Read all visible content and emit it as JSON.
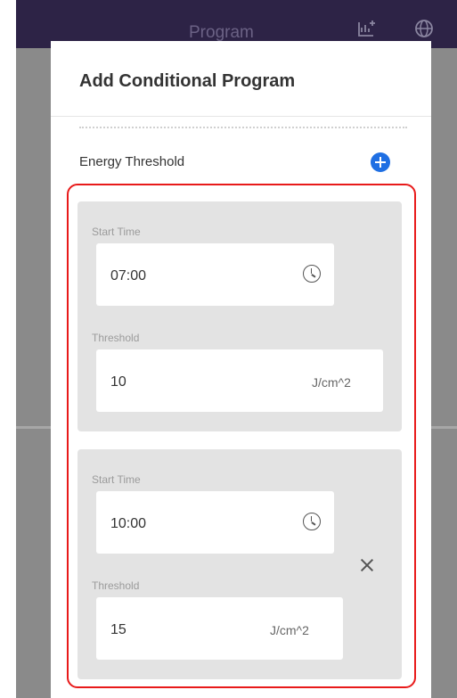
{
  "app": {
    "title": "Program",
    "header_color": "#2d2346",
    "icons": [
      "add-chart-icon",
      "globe-icon"
    ]
  },
  "modal": {
    "title": "Add Conditional Program",
    "section_label": "Energy Threshold",
    "add_icon": "plus-circle-icon",
    "accent_color": "#1f6fe3",
    "highlight_color": "#e81a1a",
    "entries": [
      {
        "start_time_label": "Start Time",
        "start_time_value": "07:00",
        "threshold_label": "Threshold",
        "threshold_value": "10",
        "threshold_unit": "J/cm^2",
        "removable": false
      },
      {
        "start_time_label": "Start Time",
        "start_time_value": "10:00",
        "threshold_label": "Threshold",
        "threshold_value": "15",
        "threshold_unit": "J/cm^2",
        "removable": true,
        "remove_icon": "close-icon"
      }
    ]
  }
}
